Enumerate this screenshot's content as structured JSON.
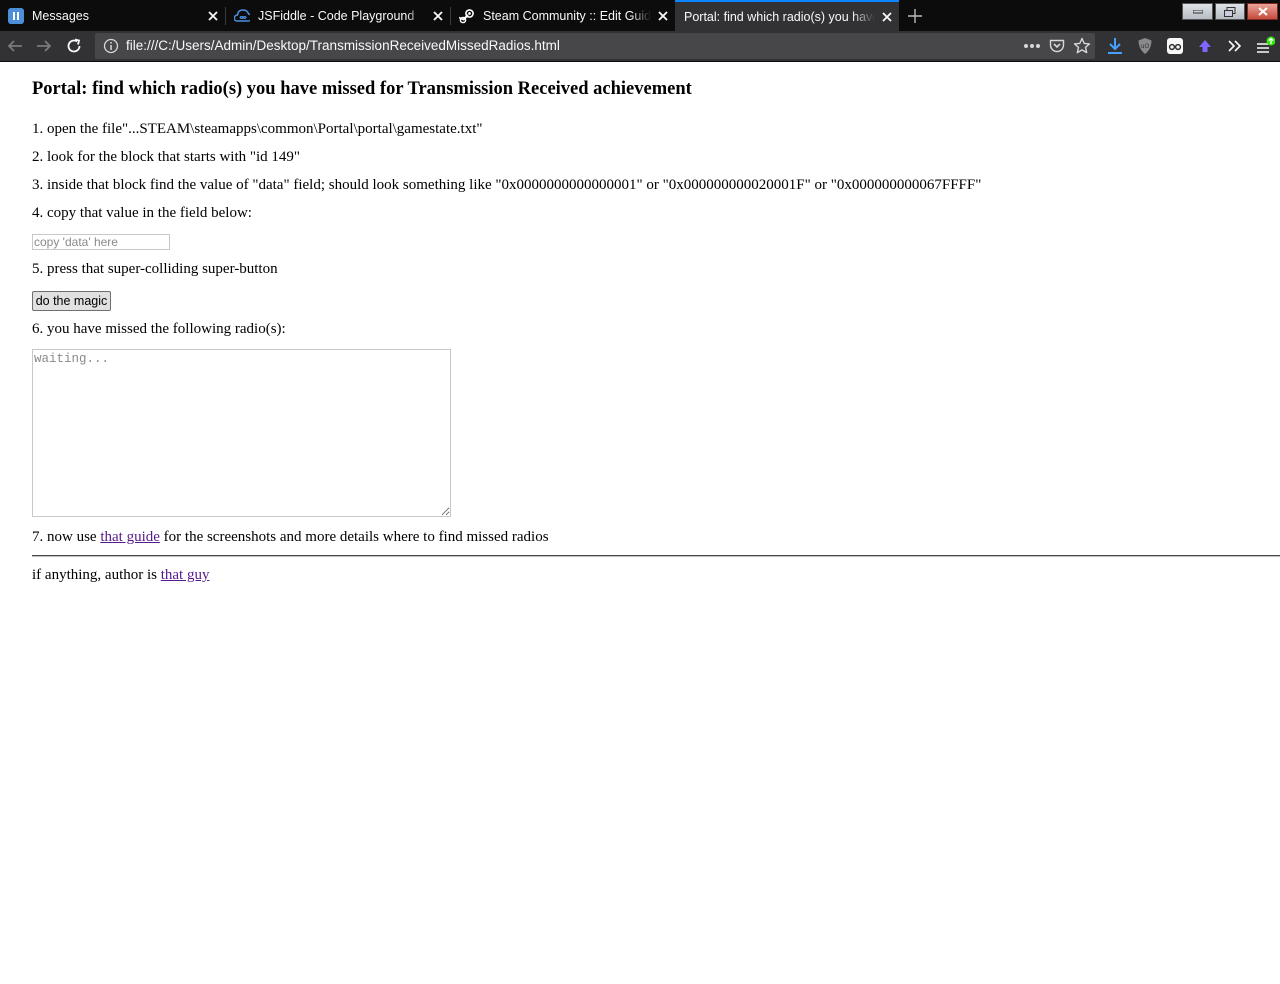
{
  "browser": {
    "tabs": [
      {
        "title": "Messages",
        "icon": "messages-app-icon"
      },
      {
        "title": "JSFiddle - Code Playground",
        "icon": "jsfiddle-icon"
      },
      {
        "title": "Steam Community :: Edit Guide",
        "icon": "steam-icon"
      },
      {
        "title": "Portal: find which radio(s) you have missed",
        "icon": "page-icon",
        "active": true
      }
    ],
    "url": "file:///C:/Users/Admin/Desktop/TransmissionReceivedMissedRadios.html",
    "accent_color": "#0a84ff"
  },
  "page": {
    "title": "Portal: find which radio(s) you have missed for Transmission Received achievement",
    "step1": "1. open the file\"...STEAM\\steamapps\\common\\Portal\\portal\\gamestate.txt\"",
    "step2": "2. look for the block that starts with \"id 149\"",
    "step3": "3. inside that block find the value of \"data\" field; should look something like \"0x0000000000000001\" or \"0x000000000020001F\" or \"0x000000000067FFFF\"",
    "step4": "4. copy that value in the field below:",
    "input_placeholder": "copy 'data' here",
    "step5": "5. press that super-colliding super-button",
    "button_label": "do the magic",
    "step6": "6. you have missed the following radio(s):",
    "result_placeholder": "waiting...",
    "step7_prefix": "7. now use",
    "step7_link": "that guide",
    "step7_suffix": "for the screenshots and more details where to find missed radios",
    "footer_prefix": "if anything, author is",
    "footer_link": "that guy",
    "link_color": "#551a8b"
  }
}
